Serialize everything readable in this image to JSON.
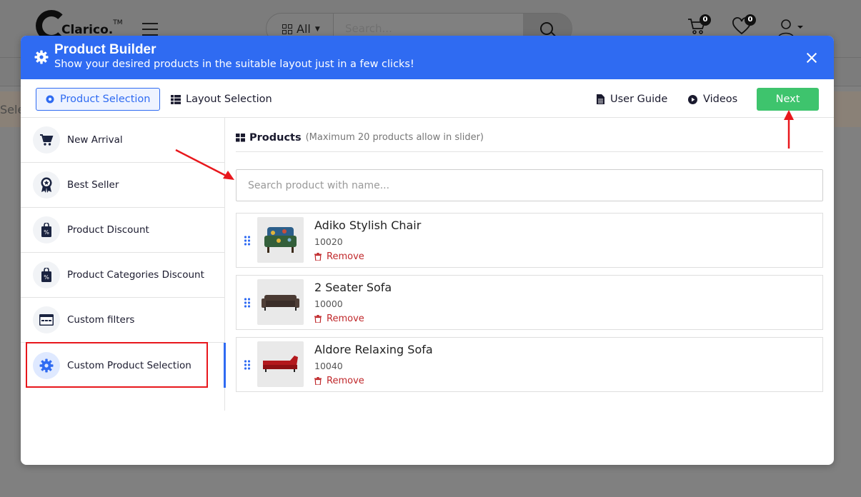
{
  "background": {
    "logo_text": "Clarico.",
    "logo_tm": "TM",
    "search_category": "All",
    "search_placeholder": "Search...",
    "cart_count": "0",
    "wishlist_count": "0",
    "notice_fragment": "Sele"
  },
  "modal": {
    "title": "Product Builder",
    "subtitle": "Show your desired products in the suitable layout just in a few clicks!",
    "tabs": [
      {
        "label": "Product Selection",
        "active": true
      },
      {
        "label": "Layout Selection",
        "active": false
      }
    ],
    "links": {
      "user_guide": "User Guide",
      "videos": "Videos"
    },
    "next_label": "Next",
    "accent_color": "#2f6bf2",
    "next_color": "#3ec46d"
  },
  "sidebar": {
    "items": [
      {
        "label": "New Arrival",
        "icon": "cart-icon"
      },
      {
        "label": "Best Seller",
        "icon": "award-ribbon-icon"
      },
      {
        "label": "Product Discount",
        "icon": "discount-bag-icon"
      },
      {
        "label": "Product Categories Discount",
        "icon": "discount-bag-icon"
      },
      {
        "label": "Custom filters",
        "icon": "browser-window-icon"
      },
      {
        "label": "Custom Product Selection",
        "icon": "gear-icon",
        "active": true
      }
    ]
  },
  "products_panel": {
    "title": "Products",
    "note": "(Maximum 20 products allow in slider)",
    "search_placeholder": "Search product with name...",
    "remove_label": "Remove",
    "items": [
      {
        "name": "Adiko Stylish Chair",
        "sku": "10020",
        "thumb": "chair"
      },
      {
        "name": "2 Seater Sofa",
        "sku": "10000",
        "thumb": "sofa-brown"
      },
      {
        "name": "Aldore Relaxing Sofa",
        "sku": "10040",
        "thumb": "sofa-red"
      }
    ]
  }
}
